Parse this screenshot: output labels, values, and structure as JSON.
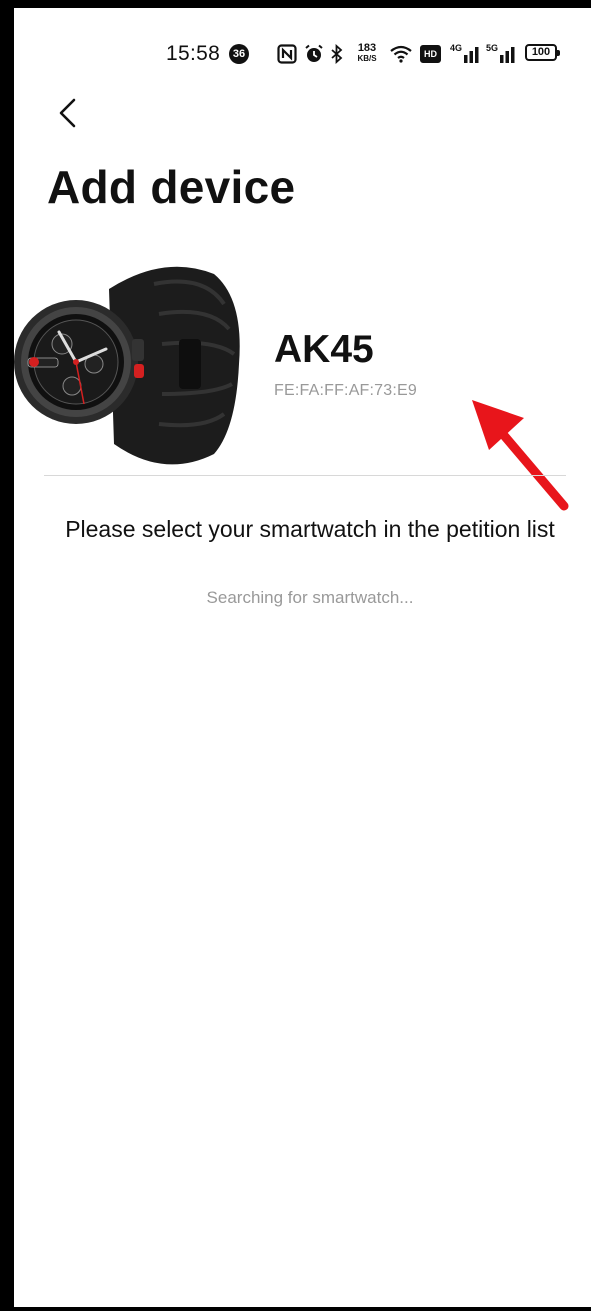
{
  "status_bar": {
    "time": "15:58",
    "notification_count": "36",
    "network_speed_value": "183",
    "network_speed_unit": "KB/S",
    "hd_label": "HD",
    "signal_4g_label": "4G",
    "signal_5g_label": "5G",
    "battery_level": "100"
  },
  "header": {
    "title": "Add device"
  },
  "device": {
    "name": "AK45",
    "mac_address": "FE:FA:FF:AF:73:E9"
  },
  "main": {
    "instruction": "Please select your smartwatch in the petition list",
    "status_text": "Searching for smartwatch..."
  },
  "colors": {
    "annotation_arrow": "#e8151b",
    "secondary_text": "#999999",
    "primary_text": "#111111"
  },
  "icons": {
    "back": "chevron-left-icon",
    "nfc": "nfc-icon",
    "alarm": "alarm-icon",
    "bluetooth": "bluetooth-icon",
    "wifi": "wifi-icon"
  }
}
